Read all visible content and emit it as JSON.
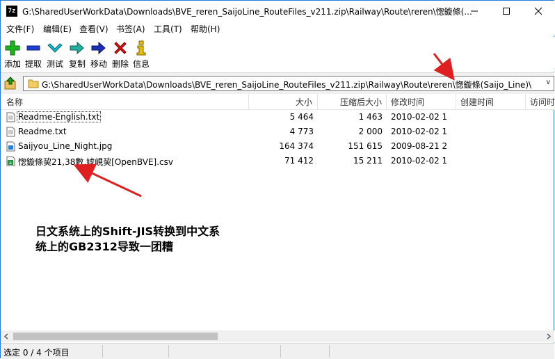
{
  "window": {
    "title": "G:\\SharedUserWorkData\\Downloads\\BVE_reren_SaijoLine_RouteFiles_v211.zip\\Railway\\Route\\reren\\愡鏇條(...",
    "app_icon_text": "7z"
  },
  "menu": [
    "文件(F)",
    "编辑(E)",
    "查看(V)",
    "书签(A)",
    "工具(T)",
    "帮助(H)"
  ],
  "toolbar": {
    "add": "添加",
    "extract": "提取",
    "test": "测试",
    "copy": "复制",
    "move": "移动",
    "delete": "删除",
    "info": "信息"
  },
  "address": {
    "path": "G:\\SharedUserWorkData\\Downloads\\BVE_reren_SaijoLine_RouteFiles_v211.zip\\Railway\\Route\\reren\\愡鏇條(Saijo_Line)\\"
  },
  "columns": [
    "名称",
    "大小",
    "压缩后大小",
    "修改时间",
    "创建时间",
    "访问时"
  ],
  "files": [
    {
      "name": "Readme-English.txt",
      "size": "5 464",
      "packed": "1 463",
      "modified": "2010-02-02 1",
      "type": "txt"
    },
    {
      "name": "Readme.txt",
      "size": "4 773",
      "packed": "2 000",
      "modified": "2010-02-02 1",
      "type": "txt"
    },
    {
      "name": "Saijyou_Line_Night.jpg",
      "size": "164 374",
      "packed": "151 615",
      "modified": "2009-08-21 2",
      "type": "img"
    },
    {
      "name": "愡鏇條巭21,38數,婋峴巭[OpenBVE].csv",
      "size": "71 412",
      "packed": "15 211",
      "modified": "2010-02-02 1",
      "type": "csv"
    }
  ],
  "annotation": {
    "line1": "日文系统上的Shift-JIS转换到中文系",
    "line2": "统上的GB2312导致一团糟"
  },
  "status": {
    "text": "选定 0 / 4 个项目"
  },
  "colors": {
    "arrow": "#e02020",
    "border": "#2b7bd6"
  }
}
